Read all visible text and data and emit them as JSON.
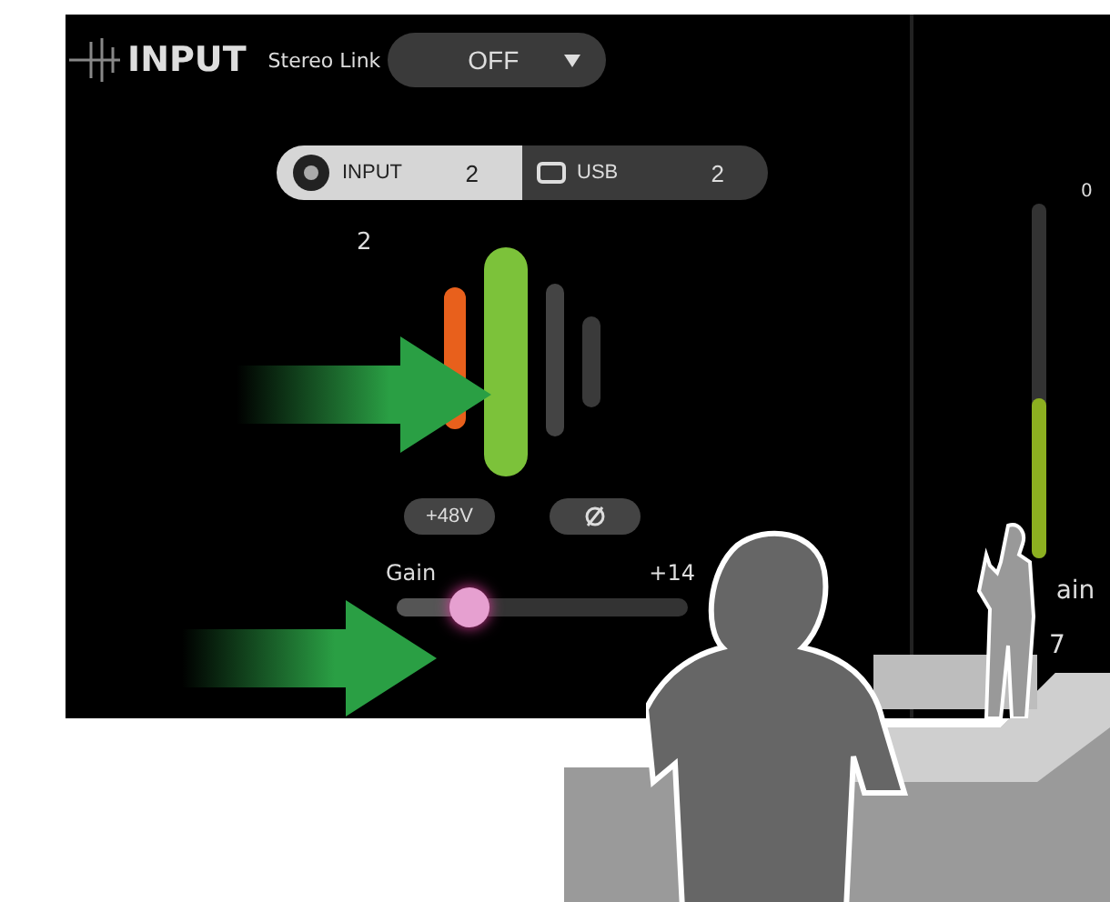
{
  "header": {
    "title": "INPUT",
    "stereo_link": {
      "label": "Stereo Link",
      "value": "OFF"
    }
  },
  "source_tabs": [
    {
      "label": "INPUT",
      "channel": "2",
      "selected": true
    },
    {
      "label": "USB",
      "channel": "2",
      "selected": false
    }
  ],
  "channel": {
    "number": "2",
    "phantom": {
      "label": "+48V",
      "on": false
    },
    "phase": {
      "on": false
    }
  },
  "gain": {
    "label": "Gain",
    "reading": "+14",
    "level": 0.25
  },
  "side_meter": {
    "tick": "0",
    "level": 0.45,
    "label": "ain",
    "value": "7"
  }
}
